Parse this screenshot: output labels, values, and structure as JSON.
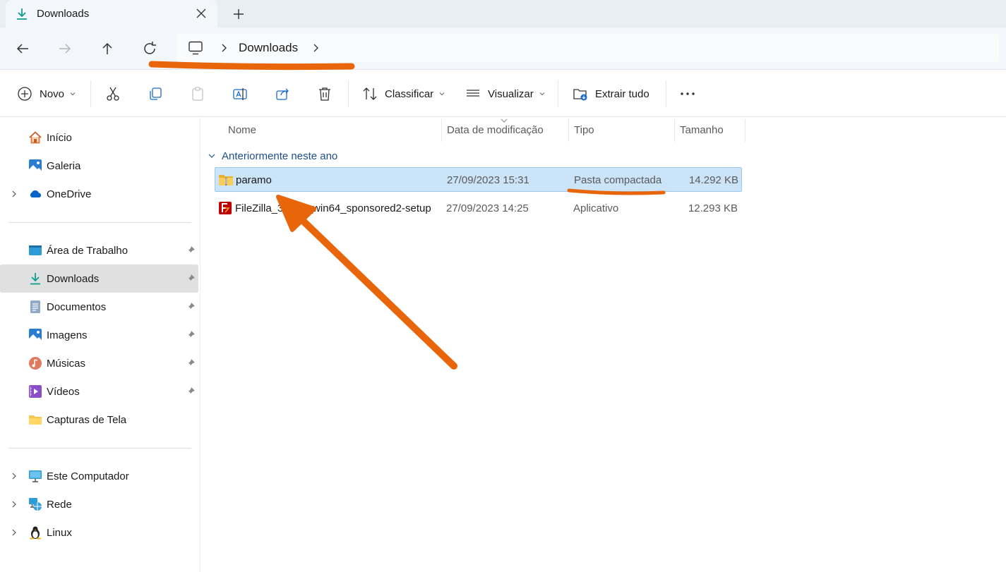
{
  "tab": {
    "title": "Downloads"
  },
  "address": {
    "crumbs": [
      "Downloads"
    ]
  },
  "toolbar": {
    "new_label": "Novo",
    "sort_label": "Classificar",
    "view_label": "Visualizar",
    "extract_label": "Extrair tudo"
  },
  "sidebar": {
    "top": [
      {
        "label": "Início",
        "icon": "home-icon"
      },
      {
        "label": "Galeria",
        "icon": "gallery-icon"
      },
      {
        "label": "OneDrive",
        "icon": "onedrive-icon"
      }
    ],
    "pinned": [
      {
        "label": "Área de Trabalho",
        "icon": "desktop-icon"
      },
      {
        "label": "Downloads",
        "icon": "downloads-icon"
      },
      {
        "label": "Documentos",
        "icon": "documents-icon"
      },
      {
        "label": "Imagens",
        "icon": "pictures-icon"
      },
      {
        "label": "Músicas",
        "icon": "music-icon"
      },
      {
        "label": "Vídeos",
        "icon": "videos-icon"
      },
      {
        "label": "Capturas de Tela",
        "icon": "folder-icon"
      }
    ],
    "bottom": [
      {
        "label": "Este Computador",
        "icon": "computer-icon"
      },
      {
        "label": "Rede",
        "icon": "network-icon"
      },
      {
        "label": "Linux",
        "icon": "linux-icon"
      }
    ]
  },
  "columns": {
    "name": "Nome",
    "modified": "Data de modificação",
    "type": "Tipo",
    "size": "Tamanho"
  },
  "group": {
    "label": "Anteriormente neste ano"
  },
  "files": [
    {
      "name": "paramo",
      "modified": "27/09/2023 15:31",
      "type": "Pasta compactada",
      "size": "14.292 KB",
      "icon": "zip-folder-icon"
    },
    {
      "name": "FileZilla_3.65.1_win64_sponsored2-setup",
      "modified": "27/09/2023 14:25",
      "type": "Aplicativo",
      "size": "12.293 KB",
      "icon": "filezilla-icon"
    }
  ],
  "colors": {
    "annotation": "#e8650a",
    "selection": "#cce4f7",
    "accent": "#0f7b6c"
  }
}
